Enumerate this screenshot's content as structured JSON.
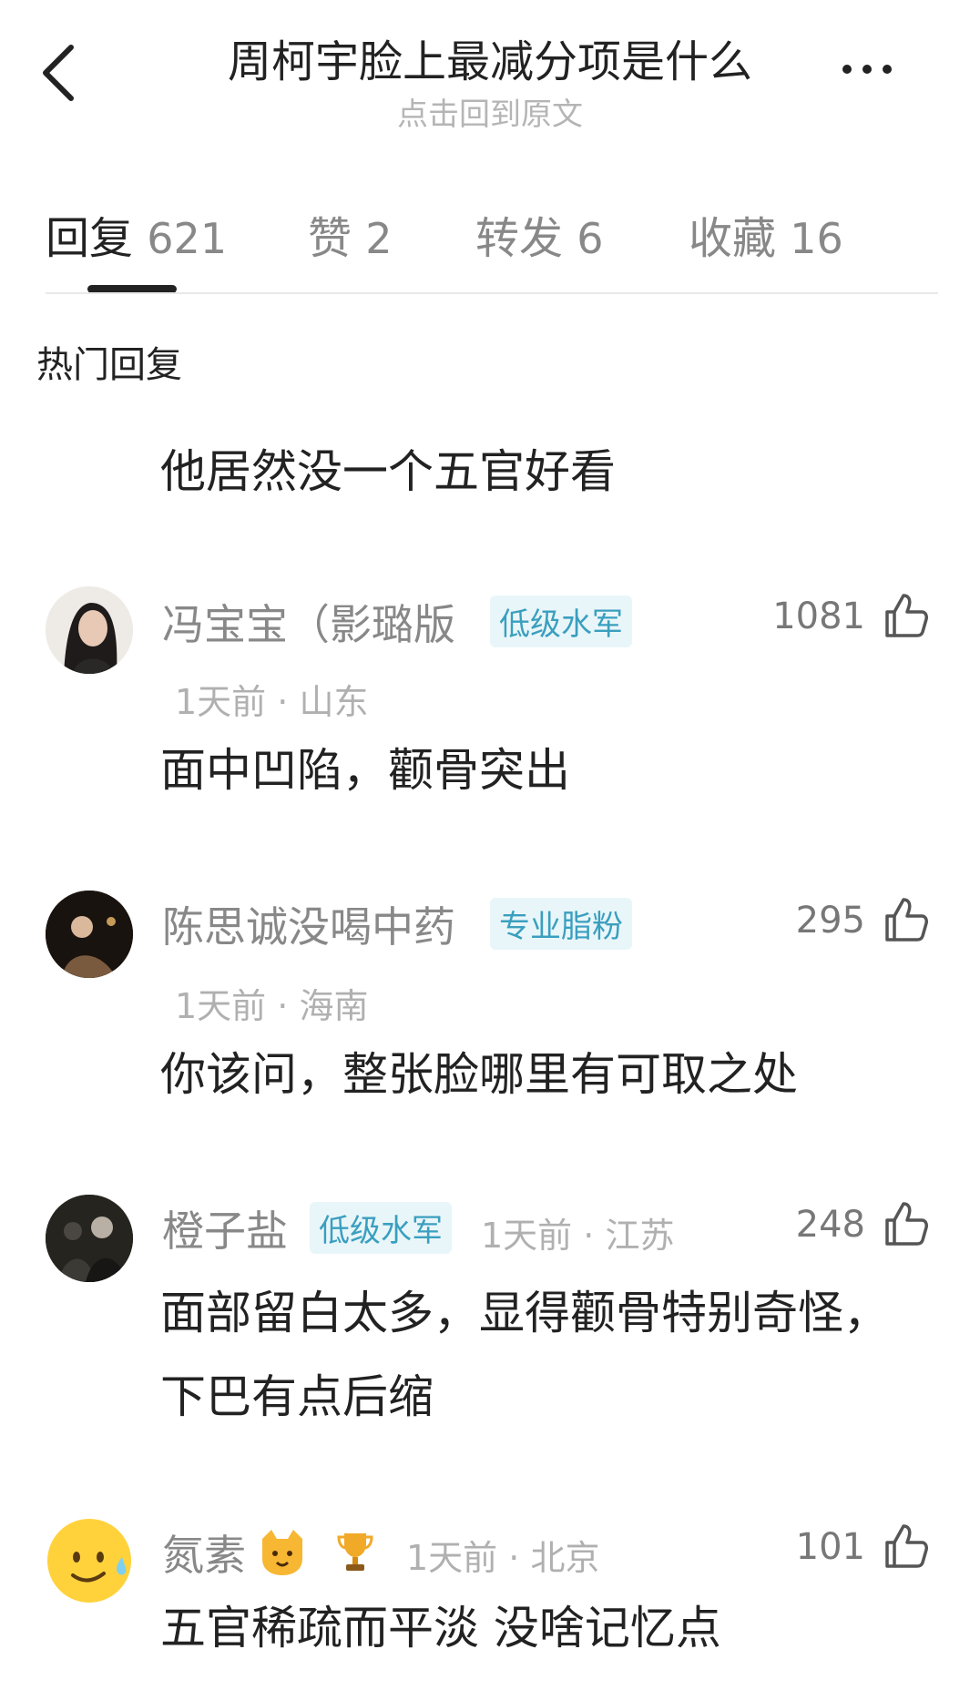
{
  "header": {
    "title": "周柯宇脸上最减分项是什么",
    "subtitle": "点击回到原文"
  },
  "tabs": [
    {
      "label": "回复",
      "count": "621"
    },
    {
      "label": "赞",
      "count": "2"
    },
    {
      "label": "转发",
      "count": "6"
    },
    {
      "label": "收藏",
      "count": "16"
    }
  ],
  "section_title": "热门回复",
  "top_reply": "他居然没一个五官好看",
  "comments": [
    {
      "user": "冯宝宝（影璐版",
      "badge": "低级水军",
      "time": "1天前",
      "location": "山东",
      "likes": "1081",
      "text": [
        "面中凹陷，颧骨突出"
      ]
    },
    {
      "user": "陈思诚没喝中药",
      "badge": "专业脂粉",
      "time": "1天前",
      "location": "海南",
      "likes": "295",
      "text": [
        "你该问，整张脸哪里有可取之处"
      ]
    },
    {
      "user": "橙子盐",
      "badge": "低级水军",
      "time": "1天前",
      "location": "江苏",
      "likes": "248",
      "text": [
        "面部留白太多，显得颧骨特别奇怪，",
        "下巴有点后缩"
      ]
    },
    {
      "user": "氮素",
      "badge": "",
      "time": "1天前",
      "location": "北京",
      "likes": "101",
      "text": [
        "五官稀疏而平淡 没啥记忆点"
      ]
    }
  ],
  "colors": {
    "badge_text": "#3a9fbf",
    "badge_bg": "#e9f6f9",
    "meta": "#b0b0b0"
  }
}
